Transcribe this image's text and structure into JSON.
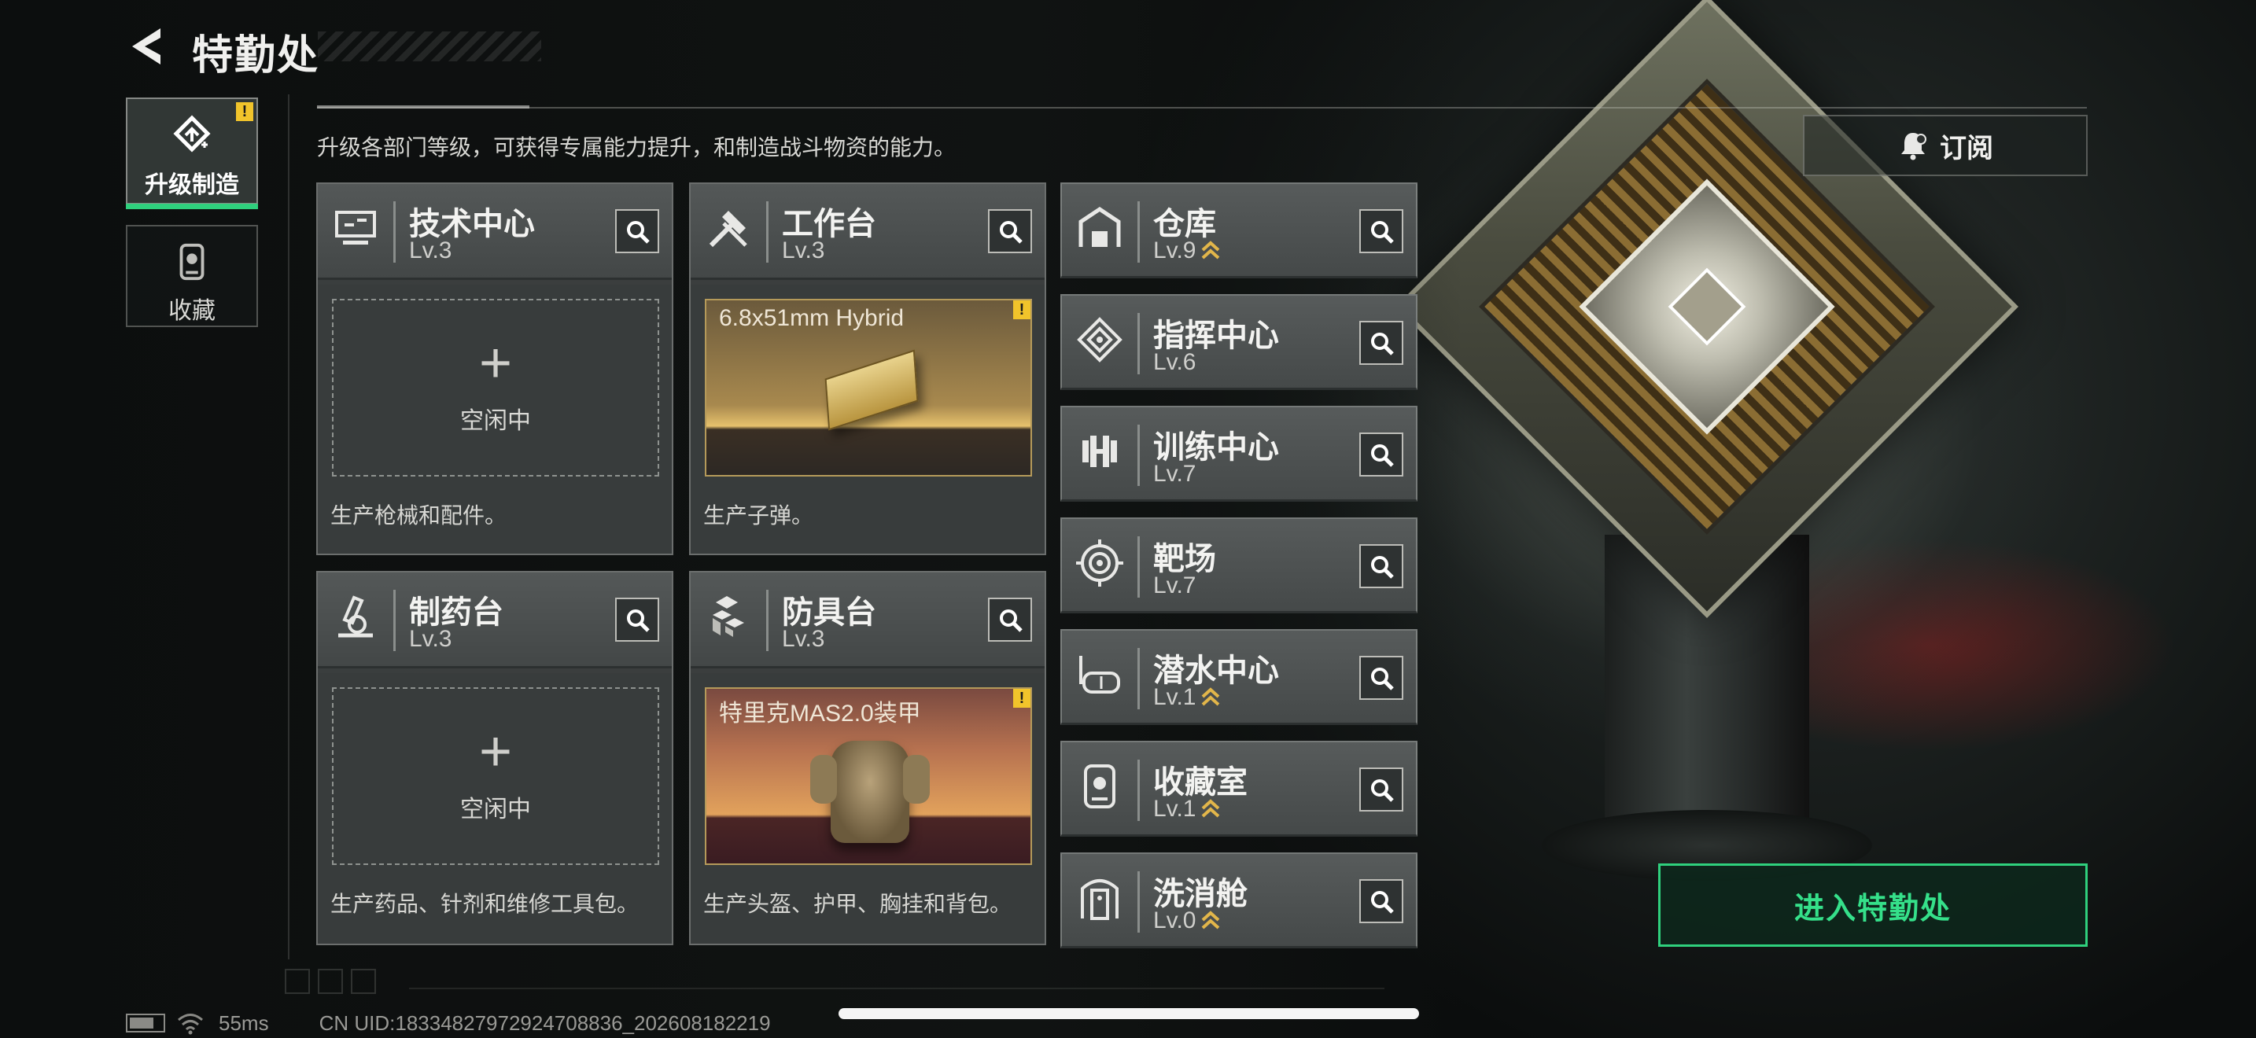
{
  "header": {
    "title": "特勤处",
    "subtitle": "升级各部门等级，可获得专属能力提升，和制造战斗物资的能力。"
  },
  "tabs": [
    {
      "label": "升级制造",
      "active": true,
      "icon": "upgrade-icon",
      "badge": "!"
    },
    {
      "label": "收藏",
      "active": false,
      "icon": "collection-icon"
    }
  ],
  "workstations": [
    {
      "name": "技术中心",
      "level": "Lv.3",
      "icon": "tech-center-icon",
      "status": "idle",
      "idle_text": "空闲中",
      "desc": "生产枪械和配件。"
    },
    {
      "name": "工作台",
      "level": "Lv.3",
      "icon": "workbench-icon",
      "status": "producing",
      "product": "6.8x51mm Hybrid",
      "badge": "!",
      "desc": "生产子弹。"
    },
    {
      "name": "制药台",
      "level": "Lv.3",
      "icon": "pharmacy-icon",
      "status": "idle",
      "idle_text": "空闲中",
      "desc": "生产药品、针剂和维修工具包。"
    },
    {
      "name": "防具台",
      "level": "Lv.3",
      "icon": "armor-bench-icon",
      "status": "producing",
      "product": "特里克MAS2.0装甲",
      "badge": "!",
      "desc": "生产头盔、护甲、胸挂和背包。"
    }
  ],
  "departments": [
    {
      "name": "仓库",
      "level": "Lv.9",
      "upgradable": true,
      "icon": "warehouse-icon"
    },
    {
      "name": "指挥中心",
      "level": "Lv.6",
      "upgradable": false,
      "icon": "command-center-icon"
    },
    {
      "name": "训练中心",
      "level": "Lv.7",
      "upgradable": false,
      "icon": "training-center-icon"
    },
    {
      "name": "靶场",
      "level": "Lv.7",
      "upgradable": false,
      "icon": "shooting-range-icon"
    },
    {
      "name": "潜水中心",
      "level": "Lv.1",
      "upgradable": true,
      "icon": "diving-center-icon"
    },
    {
      "name": "收藏室",
      "level": "Lv.1",
      "upgradable": true,
      "icon": "collection-room-icon"
    },
    {
      "name": "洗消舱",
      "level": "Lv.0",
      "upgradable": true,
      "icon": "decon-chamber-icon"
    }
  ],
  "actions": {
    "subscribe": "订阅",
    "enter": "进入特勤处"
  },
  "status": {
    "ping": "55ms",
    "uid": "CN UID:18334827972924708836_202608182219"
  },
  "colors": {
    "accent_green": "#2fd07d",
    "warning_yellow": "#f1c42b",
    "upgrade_gold": "#e2b64a"
  }
}
